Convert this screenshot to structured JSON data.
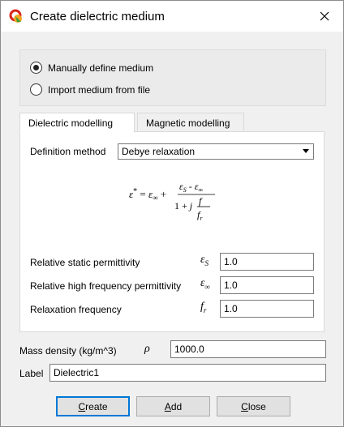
{
  "window": {
    "title": "Create dielectric medium"
  },
  "source_group": {
    "options": [
      {
        "label": "Manually define medium",
        "selected": true
      },
      {
        "label": "Import medium from file",
        "selected": false
      }
    ]
  },
  "tabs": [
    {
      "label": "Dielectric modelling",
      "active": true
    },
    {
      "label": "Magnetic modelling",
      "active": false
    }
  ],
  "dielectric": {
    "definition_method_label": "Definition method",
    "definition_method_value": "Debye relaxation",
    "fields": [
      {
        "label": "Relative static permittivity",
        "value": "1.0"
      },
      {
        "label": "Relative high frequency permittivity",
        "value": "1.0"
      },
      {
        "label": "Relaxation frequency",
        "value": "1.0"
      }
    ]
  },
  "mass_density": {
    "label": "Mass density (kg/m^3)",
    "symbol": "ρ",
    "value": "1000.0"
  },
  "label_field": {
    "label": "Label",
    "value": "Dielectric1"
  },
  "buttons": {
    "create": "Create",
    "add": "Add",
    "close": "Close"
  }
}
